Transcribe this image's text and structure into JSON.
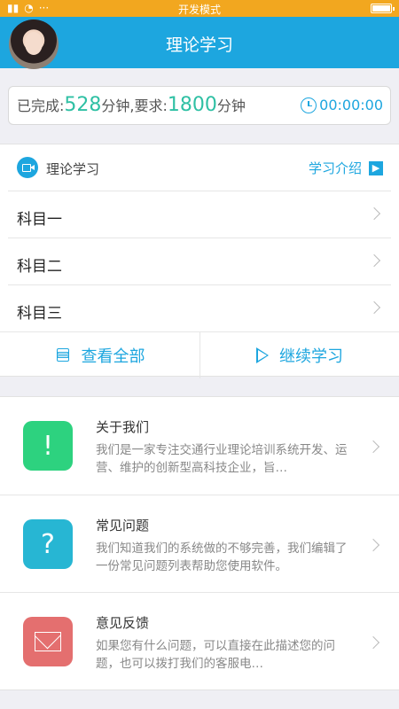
{
  "status_bar": {
    "center_text": "开发模式",
    "dots": "···"
  },
  "header": {
    "title": "理论学习"
  },
  "progress": {
    "completed_label": "已完成:",
    "completed_minutes": "528",
    "unit_1": "分钟,要求:",
    "required_minutes": "1800",
    "unit_2": "分钟",
    "timer": "00:00:00"
  },
  "study": {
    "section_label": "理论学习",
    "intro_link": "学习介绍",
    "subjects": [
      "科目一",
      "科目二",
      "科目三"
    ],
    "view_all": "查看全部",
    "continue": "继续学习"
  },
  "info": [
    {
      "title": "关于我们",
      "desc": "我们是一家专注交通行业理论培训系统开发、运营、维护的创新型高科技企业，旨…",
      "icon": "exclamation-icon",
      "color": "#2dd27f"
    },
    {
      "title": "常见问题",
      "desc": "我们知道我们的系统做的不够完善，我们编辑了一份常见问题列表帮助您使用软件。",
      "icon": "question-icon",
      "color": "#27b6d3"
    },
    {
      "title": "意见反馈",
      "desc": "如果您有什么问题，可以直接在此描述您的问题，也可以拨打我们的客服电…",
      "icon": "mail-icon",
      "color": "#e46f6f"
    }
  ]
}
